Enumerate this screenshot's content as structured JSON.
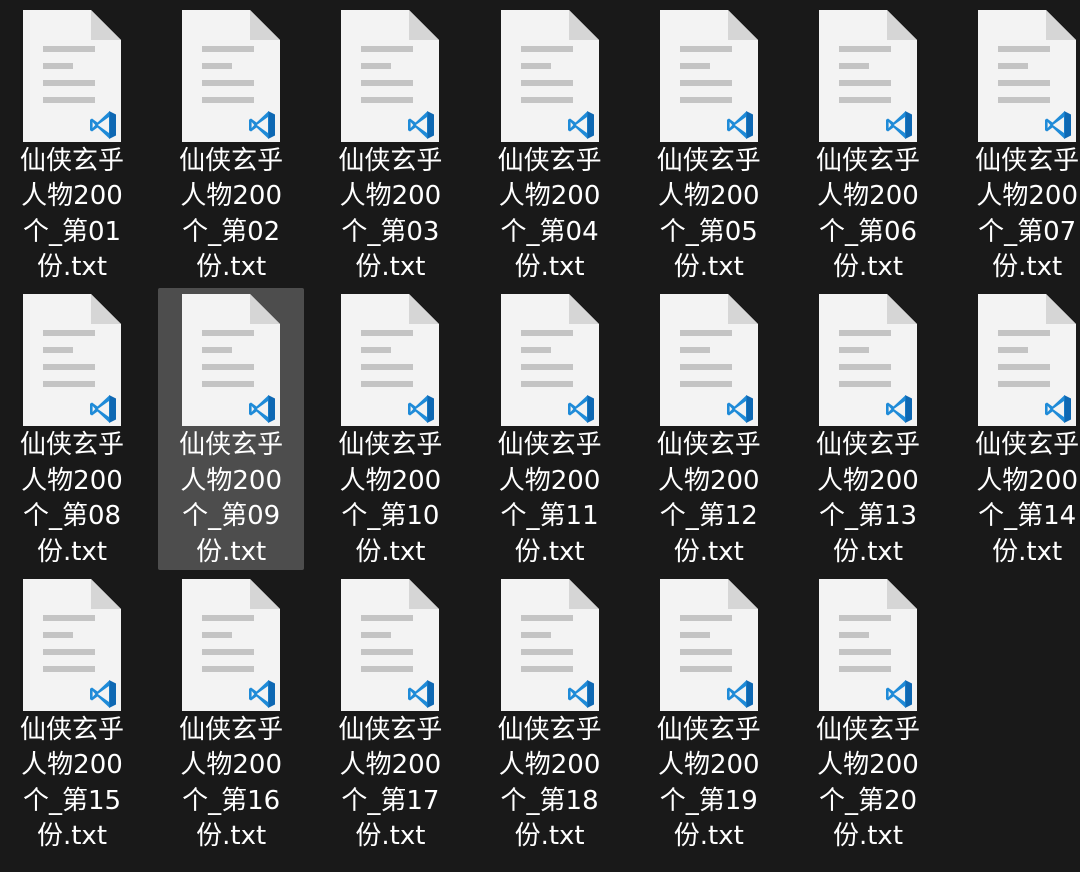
{
  "colors": {
    "background": "#191919",
    "selection": "#4d4d4d",
    "label_text": "#ffffff",
    "page_fill": "#f3f3f3",
    "page_lines": "#c4c4c4",
    "vscode_blue": "#1f8bd8"
  },
  "file_icon": "vscode-text-document-icon",
  "selected_file": "仙侠玄乎人物200个_第09份.txt",
  "files": [
    {
      "lines": [
        "仙侠玄乎",
        "人物200",
        "个_第01",
        "份.txt"
      ]
    },
    {
      "lines": [
        "仙侠玄乎",
        "人物200",
        "个_第02",
        "份.txt"
      ]
    },
    {
      "lines": [
        "仙侠玄乎",
        "人物200",
        "个_第03",
        "份.txt"
      ]
    },
    {
      "lines": [
        "仙侠玄乎",
        "人物200",
        "个_第04",
        "份.txt"
      ]
    },
    {
      "lines": [
        "仙侠玄乎",
        "人物200",
        "个_第05",
        "份.txt"
      ]
    },
    {
      "lines": [
        "仙侠玄乎",
        "人物200",
        "个_第06",
        "份.txt"
      ]
    },
    {
      "lines": [
        "仙侠玄乎",
        "人物200",
        "个_第07",
        "份.txt"
      ]
    },
    {
      "lines": [
        "仙侠玄乎",
        "人物200",
        "个_第08",
        "份.txt"
      ]
    },
    {
      "lines": [
        "仙侠玄乎",
        "人物200",
        "个_第09",
        "份.txt"
      ]
    },
    {
      "lines": [
        "仙侠玄乎",
        "人物200",
        "个_第10",
        "份.txt"
      ]
    },
    {
      "lines": [
        "仙侠玄乎",
        "人物200",
        "个_第11",
        "份.txt"
      ]
    },
    {
      "lines": [
        "仙侠玄乎",
        "人物200",
        "个_第12",
        "份.txt"
      ]
    },
    {
      "lines": [
        "仙侠玄乎",
        "人物200",
        "个_第13",
        "份.txt"
      ]
    },
    {
      "lines": [
        "仙侠玄乎",
        "人物200",
        "个_第14",
        "份.txt"
      ]
    },
    {
      "lines": [
        "仙侠玄乎",
        "人物200",
        "个_第15",
        "份.txt"
      ]
    },
    {
      "lines": [
        "仙侠玄乎",
        "人物200",
        "个_第16",
        "份.txt"
      ]
    },
    {
      "lines": [
        "仙侠玄乎",
        "人物200",
        "个_第17",
        "份.txt"
      ]
    },
    {
      "lines": [
        "仙侠玄乎",
        "人物200",
        "个_第18",
        "份.txt"
      ]
    },
    {
      "lines": [
        "仙侠玄乎",
        "人物200",
        "个_第19",
        "份.txt"
      ]
    },
    {
      "lines": [
        "仙侠玄乎",
        "人物200",
        "个_第20",
        "份.txt"
      ]
    }
  ]
}
